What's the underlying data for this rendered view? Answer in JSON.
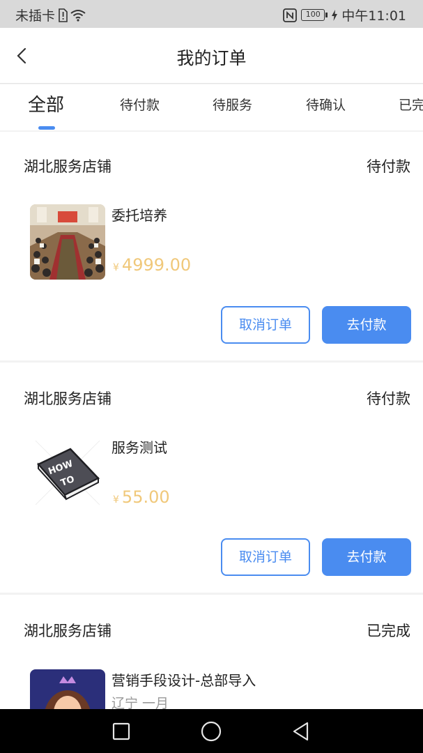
{
  "status_bar": {
    "carrier": "未插卡",
    "battery": "100",
    "time": "中午11:01"
  },
  "header": {
    "title": "我的订单"
  },
  "tabs": [
    {
      "label": "全部",
      "active": true
    },
    {
      "label": "待付款",
      "active": false
    },
    {
      "label": "待服务",
      "active": false
    },
    {
      "label": "待确认",
      "active": false
    },
    {
      "label": "已完",
      "active": false
    }
  ],
  "orders": [
    {
      "shop": "湖北服务店铺",
      "status": "待付款",
      "item_title": "委托培养",
      "currency": "¥",
      "price": "4999.00",
      "cancel_label": "取消订单",
      "pay_label": "去付款"
    },
    {
      "shop": "湖北服务店铺",
      "status": "待付款",
      "item_title": "服务测试",
      "currency": "¥",
      "price": "55.00",
      "book_text_1": "HOW",
      "book_text_2": "TO",
      "cancel_label": "取消订单",
      "pay_label": "去付款"
    },
    {
      "shop": "湖北服务店铺",
      "status": "已完成",
      "item_title": "营销手段设计-总部导入",
      "item_sub": "辽宁 一月"
    }
  ],
  "colors": {
    "accent": "#4a8cf0",
    "price": "#f0c87a",
    "status_bar_bg": "#d9d9d9"
  }
}
